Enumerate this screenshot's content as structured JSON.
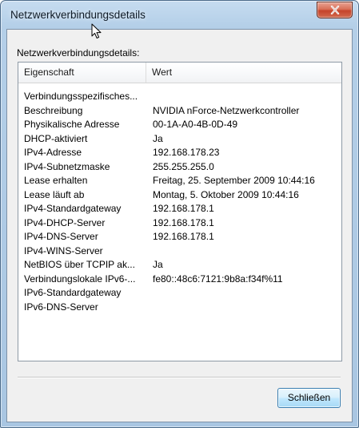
{
  "window": {
    "title": "Netzwerkverbindungsdetails"
  },
  "group_label": "Netzwerkverbindungsdetails:",
  "table": {
    "columns": [
      "Eigenschaft",
      "Wert"
    ],
    "rows": [
      {
        "k": "Verbindungsspezifisches...",
        "v": ""
      },
      {
        "k": "Beschreibung",
        "v": "NVIDIA nForce-Netzwerkcontroller"
      },
      {
        "k": "Physikalische Adresse",
        "v": "00-1A-A0-4B-0D-49"
      },
      {
        "k": "DHCP-aktiviert",
        "v": "Ja"
      },
      {
        "k": "IPv4-Adresse",
        "v": "192.168.178.23"
      },
      {
        "k": "IPv4-Subnetzmaske",
        "v": "255.255.255.0"
      },
      {
        "k": "Lease erhalten",
        "v": "Freitag, 25. September 2009 10:44:16"
      },
      {
        "k": "Lease läuft ab",
        "v": "Montag, 5. Oktober 2009 10:44:16"
      },
      {
        "k": "IPv4-Standardgateway",
        "v": "192.168.178.1"
      },
      {
        "k": "IPv4-DHCP-Server",
        "v": "192.168.178.1"
      },
      {
        "k": "IPv4-DNS-Server",
        "v": "192.168.178.1"
      },
      {
        "k": "IPv4-WINS-Server",
        "v": ""
      },
      {
        "k": "NetBIOS über TCPIP ak...",
        "v": "Ja"
      },
      {
        "k": "Verbindungslokale IPv6-...",
        "v": "fe80::48c6:7121:9b8a:f34f%11"
      },
      {
        "k": "IPv6-Standardgateway",
        "v": ""
      },
      {
        "k": "IPv6-DNS-Server",
        "v": ""
      }
    ]
  },
  "buttons": {
    "close_label": "Schließen"
  },
  "icons": {
    "close": "close-icon",
    "cursor": "mouse-cursor-icon"
  }
}
